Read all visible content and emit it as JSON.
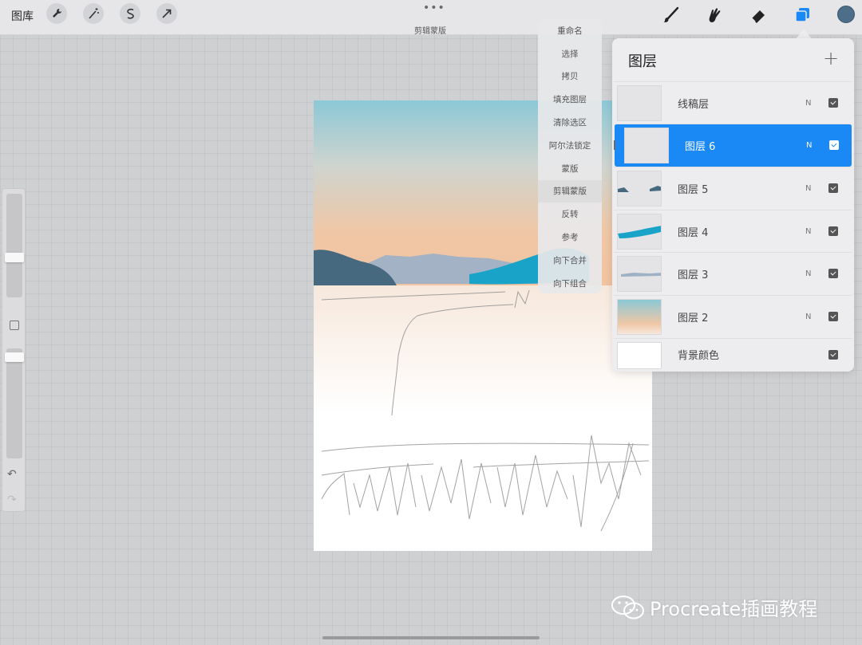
{
  "topbar": {
    "gallery_label": "图库",
    "dots": "•••",
    "mode_label": "剪辑蒙版",
    "active_color": "#4c6e88"
  },
  "context_menu": {
    "items": [
      "重命名",
      "选择",
      "拷贝",
      "填充图层",
      "清除选区",
      "阿尔法锁定",
      "蒙版",
      "剪辑蒙版",
      "反转",
      "参考",
      "向下合并",
      "向下组合"
    ],
    "active_index": 7
  },
  "layers": {
    "title": "图层",
    "add_label": "+",
    "rows": [
      {
        "name": "线稿层",
        "blend": "N",
        "visible": true,
        "selected": false
      },
      {
        "name": "图层 6",
        "blend": "N",
        "visible": true,
        "selected": true
      },
      {
        "name": "图层 5",
        "blend": "N",
        "visible": true,
        "selected": false
      },
      {
        "name": "图层 4",
        "blend": "N",
        "visible": true,
        "selected": false
      },
      {
        "name": "图层 3",
        "blend": "N",
        "visible": true,
        "selected": false
      },
      {
        "name": "图层 2",
        "blend": "N",
        "visible": true,
        "selected": false
      },
      {
        "name": "背景颜色",
        "blend": "",
        "visible": true,
        "selected": false
      }
    ],
    "selected_color": "#1a88f5"
  },
  "sidebar": {
    "undo_icon": "↶",
    "redo_icon": "↷"
  },
  "watermark": {
    "text": "Procreate插画教程"
  }
}
